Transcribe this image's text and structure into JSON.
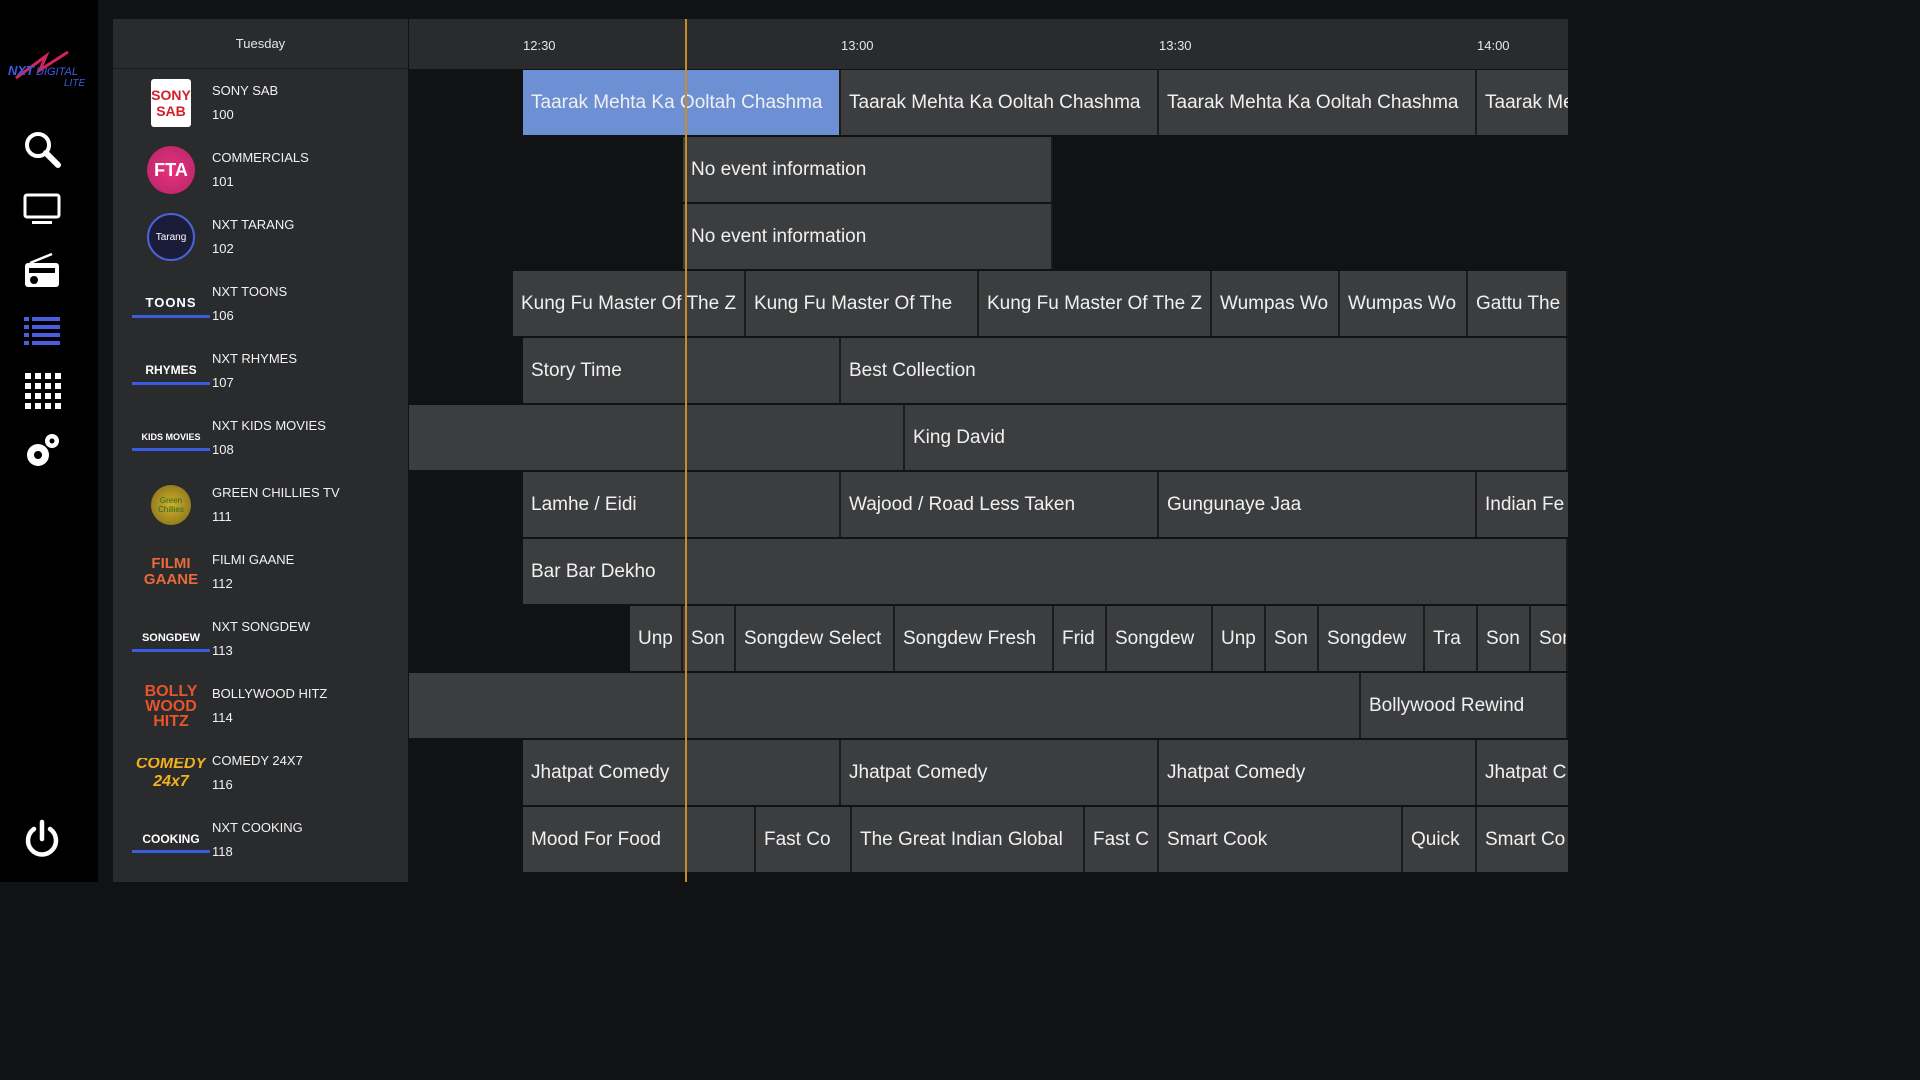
{
  "app": {
    "logo_text": "NXT DIGITAL LITE"
  },
  "sidebar": {
    "items": [
      {
        "icon": "search-icon"
      },
      {
        "icon": "tv-icon"
      },
      {
        "icon": "radio-icon"
      },
      {
        "icon": "list-icon",
        "active": true
      },
      {
        "icon": "apps-grid-icon"
      },
      {
        "icon": "settings-icon"
      },
      {
        "icon": "power-icon"
      }
    ]
  },
  "colors": {
    "accent": "#6d90d4",
    "nowline": "#c98a2a",
    "active_nav": "#4a5fe0"
  },
  "guide": {
    "day": "Tuesday",
    "times": [
      "12:30",
      "13:00",
      "13:30",
      "14:00"
    ],
    "channels": [
      {
        "name": "SONY SAB",
        "number": "100",
        "logo": "SONY SAB"
      },
      {
        "name": "COMMERCIALS",
        "number": "101",
        "logo": "FTA"
      },
      {
        "name": "NXT TARANG",
        "number": "102",
        "logo": "Tarang"
      },
      {
        "name": "NXT TOONS",
        "number": "106",
        "logo": "TOONS"
      },
      {
        "name": "NXT RHYMES",
        "number": "107",
        "logo": "RHYMES"
      },
      {
        "name": "NXT KIDS MOVIES",
        "number": "108",
        "logo": "KIDS MOVIES"
      },
      {
        "name": "GREEN CHILLIES TV",
        "number": "111",
        "logo": "Green Chillies"
      },
      {
        "name": "FILMI GAANE",
        "number": "112",
        "logo": "FILMI GAANE"
      },
      {
        "name": "NXT SONGDEW",
        "number": "113",
        "logo": "SONGDEW"
      },
      {
        "name": "BOLLYWOOD HITZ",
        "number": "114",
        "logo": "BOLLY WOOD HITZ"
      },
      {
        "name": "COMEDY 24X7",
        "number": "116",
        "logo": "COMEDY 24x7"
      },
      {
        "name": "NXT COOKING",
        "number": "118",
        "logo": "COOKING"
      }
    ],
    "programs": [
      [
        {
          "title": "Taarak Mehta Ka Ooltah Chashma",
          "selected": true
        },
        {
          "title": "Taarak Mehta Ka Ooltah Chashma"
        },
        {
          "title": "Taarak Mehta Ka Ooltah Chashma"
        },
        {
          "title": "Taarak Me"
        }
      ],
      [
        {
          "title": "No event information"
        }
      ],
      [
        {
          "title": "No event information"
        }
      ],
      [
        {
          "title": "Kung Fu Master Of The Z"
        },
        {
          "title": "Kung Fu Master Of The"
        },
        {
          "title": "Kung Fu Master Of The Z"
        },
        {
          "title": "Wumpas Wo"
        },
        {
          "title": "Wumpas Wo"
        },
        {
          "title": "Gattu The"
        }
      ],
      [
        {
          "title": "Story Time"
        },
        {
          "title": "Best Collection"
        }
      ],
      [
        {
          "title": ""
        },
        {
          "title": "King David"
        }
      ],
      [
        {
          "title": "Lamhe / Eidi"
        },
        {
          "title": "Wajood / Road Less Taken"
        },
        {
          "title": "Gungunaye Jaa"
        },
        {
          "title": "Indian Fe"
        }
      ],
      [
        {
          "title": "Bar Bar Dekho"
        }
      ],
      [
        {
          "title": "Unp"
        },
        {
          "title": "Son"
        },
        {
          "title": "Songdew Select"
        },
        {
          "title": "Songdew Fresh"
        },
        {
          "title": "Frid"
        },
        {
          "title": "Songdew"
        },
        {
          "title": "Unp"
        },
        {
          "title": "Son"
        },
        {
          "title": "Songdew"
        },
        {
          "title": "Tra"
        },
        {
          "title": "Son"
        },
        {
          "title": "Son"
        }
      ],
      [
        {
          "title": ""
        },
        {
          "title": "Bollywood Rewind"
        }
      ],
      [
        {
          "title": "Jhatpat Comedy"
        },
        {
          "title": "Jhatpat Comedy"
        },
        {
          "title": "Jhatpat Comedy"
        },
        {
          "title": "Jhatpat C"
        }
      ],
      [
        {
          "title": "Mood For Food"
        },
        {
          "title": "Fast Co"
        },
        {
          "title": "The Great Indian Global"
        },
        {
          "title": "Fast C"
        },
        {
          "title": "Smart Cook"
        },
        {
          "title": "Quick"
        },
        {
          "title": "Smart Co"
        }
      ]
    ]
  }
}
